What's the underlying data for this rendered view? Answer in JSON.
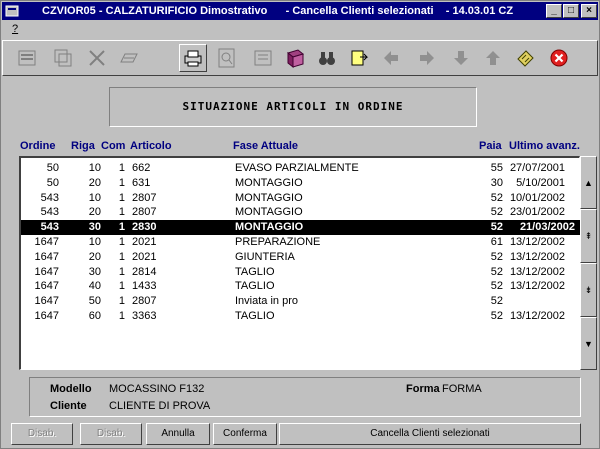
{
  "titlebar": {
    "title": "CZVIOR05 - CALZATURIFICIO Dimostrativo      - Cancella Clienti selezionati    - 14.03.01 CZ",
    "min_label": "_",
    "max_label": "□",
    "close_label": "×"
  },
  "menubar": {
    "help_label": "?"
  },
  "banner": {
    "title": "SITUAZIONE ARTICOLI IN ORDINE"
  },
  "columns": {
    "ordine": "Ordine",
    "riga": "Riga",
    "com": "Com",
    "articolo": "Articolo",
    "fase": "Fase Attuale",
    "paia": "Paia",
    "ultimo": "Ultimo avanz."
  },
  "rows": [
    {
      "ordine": "50",
      "riga": "10",
      "com": "1",
      "articolo": "662",
      "fase": "EVASO PARZIALMENTE",
      "paia": "55",
      "ultimo": "27/07/2001"
    },
    {
      "ordine": "50",
      "riga": "20",
      "com": "1",
      "articolo": "631",
      "fase": "MONTAGGIO",
      "paia": "30",
      "ultimo": "5/10/2001"
    },
    {
      "ordine": "543",
      "riga": "10",
      "com": "1",
      "articolo": "2807",
      "fase": "MONTAGGIO",
      "paia": "52",
      "ultimo": "10/01/2002"
    },
    {
      "ordine": "543",
      "riga": "20",
      "com": "1",
      "articolo": "2807",
      "fase": "MONTAGGIO",
      "paia": "52",
      "ultimo": "23/01/2002"
    },
    {
      "ordine": "543",
      "riga": "30",
      "com": "1",
      "articolo": "2830",
      "fase": "MONTAGGIO",
      "paia": "52",
      "ultimo": "21/03/2002"
    },
    {
      "ordine": "1647",
      "riga": "10",
      "com": "1",
      "articolo": "2021",
      "fase": "PREPARAZIONE",
      "paia": "61",
      "ultimo": "13/12/2002"
    },
    {
      "ordine": "1647",
      "riga": "20",
      "com": "1",
      "articolo": "2021",
      "fase": "GIUNTERIA",
      "paia": "52",
      "ultimo": "13/12/2002"
    },
    {
      "ordine": "1647",
      "riga": "30",
      "com": "1",
      "articolo": "2814",
      "fase": "TAGLIO",
      "paia": "52",
      "ultimo": "13/12/2002"
    },
    {
      "ordine": "1647",
      "riga": "40",
      "com": "1",
      "articolo": "1433",
      "fase": "TAGLIO",
      "paia": "52",
      "ultimo": "13/12/2002"
    },
    {
      "ordine": "1647",
      "riga": "50",
      "com": "1",
      "articolo": "2807",
      "fase": "Inviata in pro",
      "paia": "52",
      "ultimo": ""
    },
    {
      "ordine": "1647",
      "riga": "60",
      "com": "1",
      "articolo": "3363",
      "fase": "TAGLIO",
      "paia": "52",
      "ultimo": "13/12/2002"
    }
  ],
  "selected_row": 4,
  "scroll": {
    "top": "▲",
    "pageup": "⇞",
    "pagedown": "⇟",
    "bottom": "▼"
  },
  "info": {
    "modello_label": "Modello",
    "modello_value": "MOCASSINO  F132",
    "forma_label": "Forma",
    "forma_value": "FORMA",
    "cliente_label": "Cliente",
    "cliente_value": "CLIENTE DI PROVA"
  },
  "buttons": {
    "disab1": "Disab.",
    "disab2": "Disab.",
    "annulla": "Annulla",
    "conferma": "Conferma",
    "cancella": "Cancella Clienti selezionati"
  },
  "colors": {
    "titlebar": "#000080",
    "header_text": "#000080",
    "selection": "#000000"
  }
}
